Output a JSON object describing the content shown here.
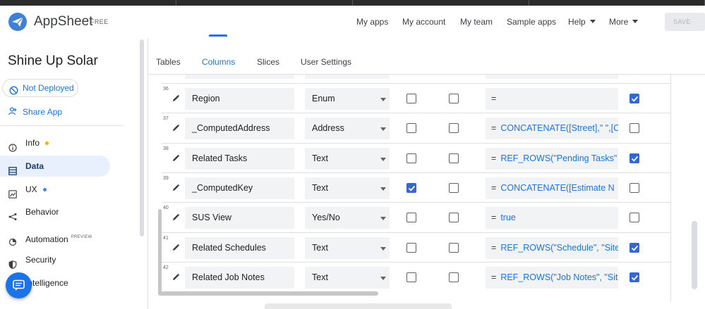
{
  "header": {
    "brand": "AppSheet",
    "plan": "FREE",
    "nav": [
      {
        "label": "My apps"
      },
      {
        "label": "My account"
      },
      {
        "label": "My team"
      },
      {
        "label": "Sample apps"
      },
      {
        "label": "Help"
      },
      {
        "label": "More"
      }
    ],
    "save_label": "SAVE"
  },
  "sidebar": {
    "app_name": "Shine Up Solar",
    "deploy_status": "Not Deployed",
    "share_label": "Share App",
    "items": [
      {
        "label": "Info",
        "icon": "info-icon",
        "dot_color": "#f9ab00"
      },
      {
        "label": "Data",
        "icon": "data-icon",
        "active": true
      },
      {
        "label": "UX",
        "icon": "ux-icon",
        "dot_color": "#4285f4"
      },
      {
        "label": "Behavior",
        "icon": "behavior-icon"
      },
      {
        "label": "Automation",
        "icon": "automation-icon",
        "badge": "PREVIEW"
      },
      {
        "label": "Security",
        "icon": "shield-icon"
      },
      {
        "label": "Intelligence",
        "icon": "intelligence-icon"
      }
    ]
  },
  "tabs": [
    {
      "label": "Tables"
    },
    {
      "label": "Columns",
      "active": true
    },
    {
      "label": "Slices"
    },
    {
      "label": "User Settings"
    }
  ],
  "columns": [
    {
      "num": "36",
      "name": "Region",
      "type": "Enum",
      "c1": false,
      "c2": false,
      "formula": "",
      "c3": true
    },
    {
      "num": "37",
      "name": "_ComputedAddress",
      "type": "Address",
      "c1": false,
      "c2": false,
      "formula": "CONCATENATE([Street],\" \",[C",
      "c3": false
    },
    {
      "num": "38",
      "name": "Related Tasks",
      "type": "Text",
      "c1": false,
      "c2": false,
      "formula": "REF_ROWS(\"Pending Tasks\"",
      "c3": true
    },
    {
      "num": "39",
      "name": "_ComputedKey",
      "type": "Text",
      "c1": true,
      "c2": false,
      "formula": "CONCATENATE([Estimate N",
      "c3": false
    },
    {
      "num": "40",
      "name": "SUS View",
      "type": "Yes/No",
      "c1": false,
      "c2": false,
      "formula": "true",
      "c3": false
    },
    {
      "num": "41",
      "name": "Related Schedules",
      "type": "Text",
      "c1": false,
      "c2": false,
      "formula": "REF_ROWS(\"Schedule\", \"Site",
      "c3": true
    },
    {
      "num": "42",
      "name": "Related Job Notes",
      "type": "Text",
      "c1": false,
      "c2": false,
      "formula": "REF_ROWS(\"Job Notes\", \"Sit",
      "c3": true
    }
  ],
  "formula_prefix": "=",
  "colors": {
    "accent": "#1a73e8",
    "checkbox": "#3367d6",
    "field_bg": "#f1f3f4",
    "active_nav_bg": "#e8f0fe"
  }
}
